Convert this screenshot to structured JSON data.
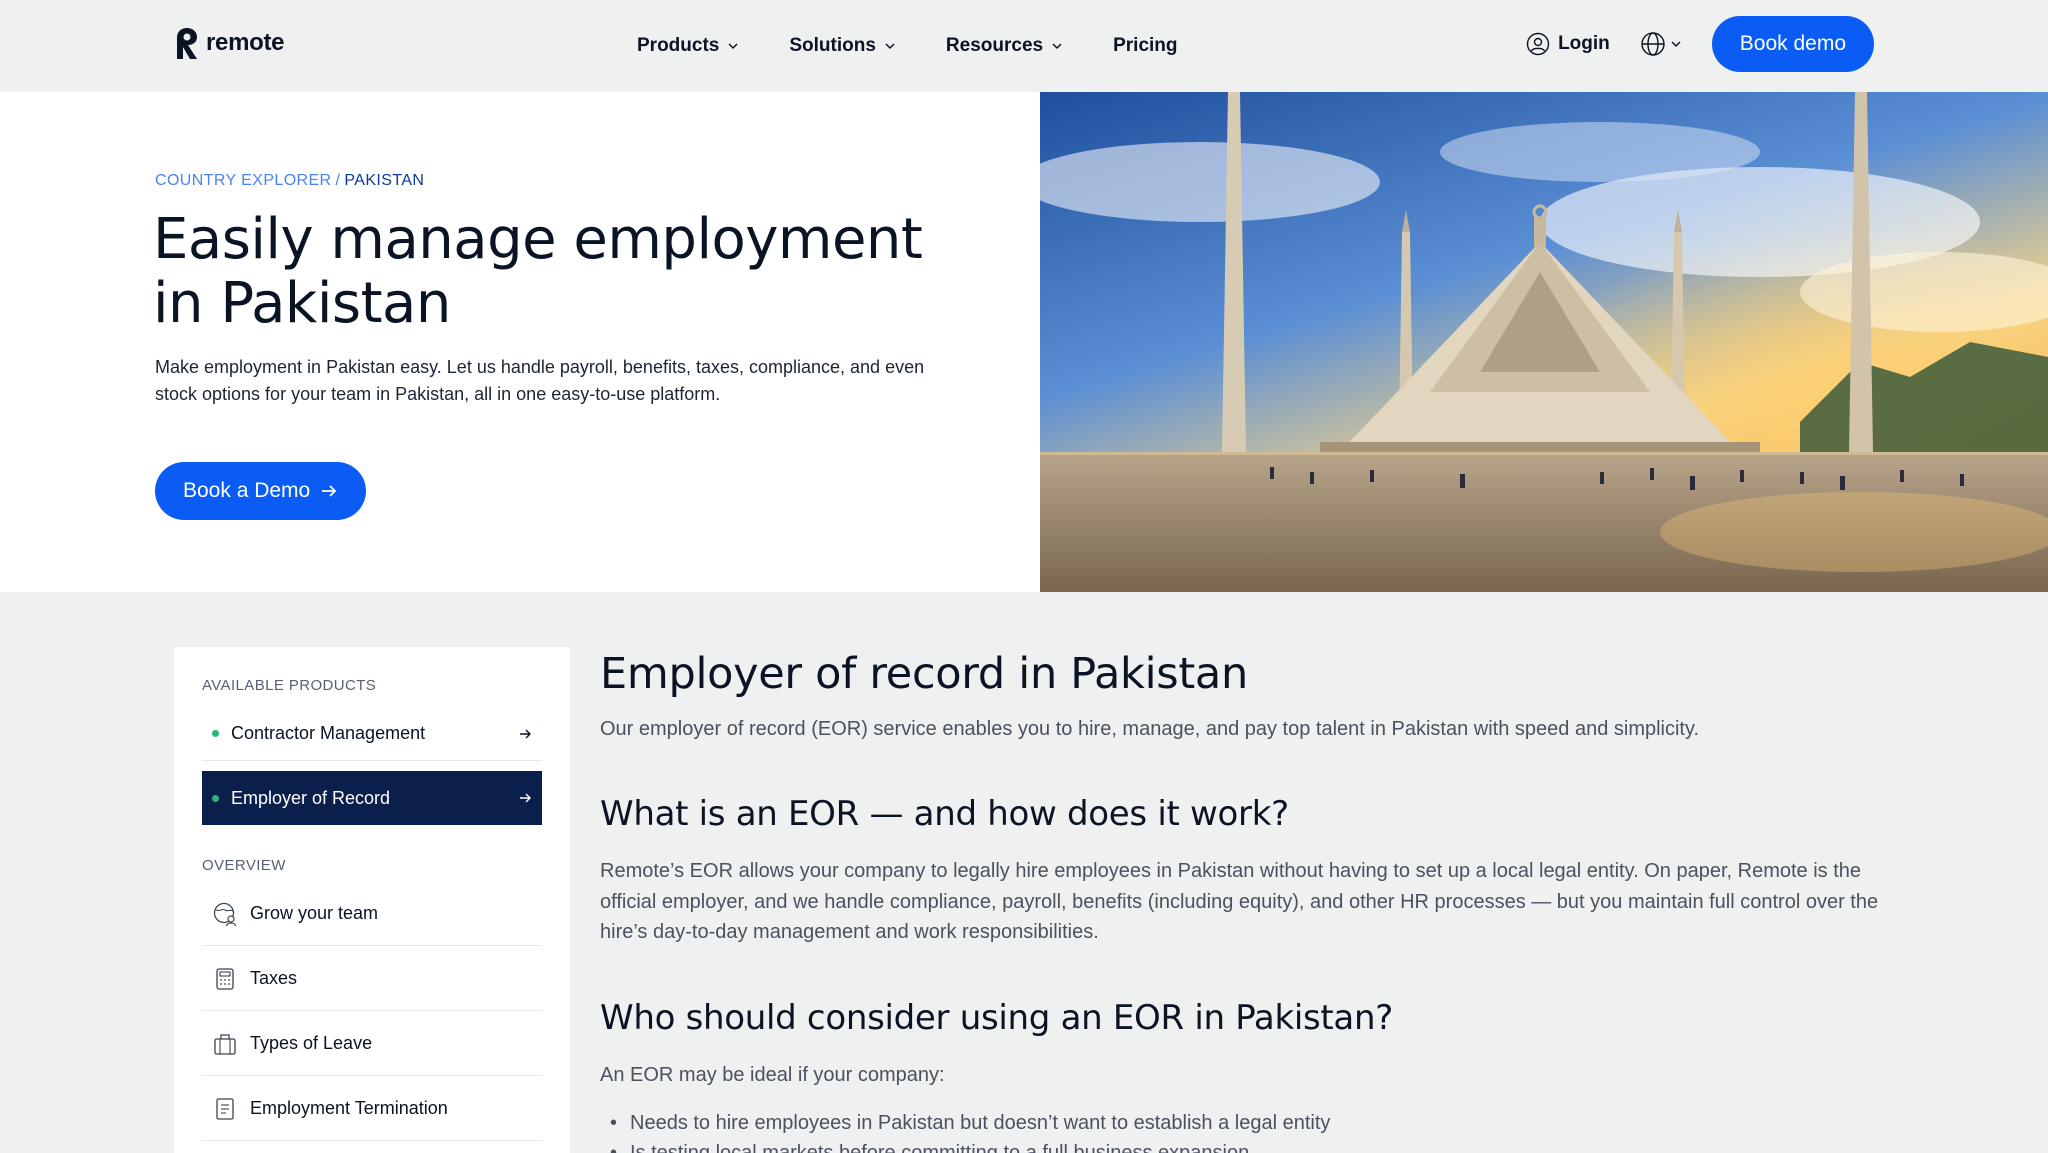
{
  "brand": {
    "name": "remote",
    "accent": "#0a5cf5",
    "navy": "#0b1f4d",
    "green_dot": "#2bb673"
  },
  "nav": {
    "menu": [
      {
        "label": "Products",
        "has_dropdown": true
      },
      {
        "label": "Solutions",
        "has_dropdown": true
      },
      {
        "label": "Resources",
        "has_dropdown": true
      },
      {
        "label": "Pricing",
        "has_dropdown": false
      }
    ],
    "login_label": "Login",
    "language_icon": "globe-icon",
    "cta_label": "Book demo"
  },
  "hero": {
    "breadcrumb": [
      "COUNTRY EXPLORER",
      "PAKISTAN"
    ],
    "breadcrumb_sep": "/",
    "title": "Easily manage employment in Pakistan",
    "description": "Make employment in Pakistan easy. Let us handle payroll, benefits, taxes, compliance, and even stock options for your team in Pakistan, all in one easy-to-use platform.",
    "cta_label": "Book a Demo"
  },
  "sidebar": {
    "products_heading": "AVAILABLE PRODUCTS",
    "products": [
      {
        "label": "Contractor Management",
        "active": false
      },
      {
        "label": "Employer of Record",
        "active": true
      }
    ],
    "overview_heading": "OVERVIEW",
    "overview": [
      {
        "label": "Grow your team",
        "icon": "globe-people-icon"
      },
      {
        "label": "Taxes",
        "icon": "calculator-icon"
      },
      {
        "label": "Types of Leave",
        "icon": "luggage-icon"
      },
      {
        "label": "Employment Termination",
        "icon": "document-icon"
      }
    ]
  },
  "main": {
    "heading_1": "Employer of record in Pakistan",
    "intro": "Our employer of record (EOR) service enables you to hire, manage, and pay top talent in Pakistan with speed and simplicity.",
    "heading_2": "What is an EOR — and how does it work?",
    "paragraph_2": "Remote’s EOR allows your company to legally hire employees in Pakistan without having to set up a local legal entity. On paper, Remote is the official employer, and we handle compliance, payroll, benefits (including equity), and other HR processes — but you maintain full control over the hire’s day-to-day management and work responsibilities.",
    "heading_3": "Who should consider using an EOR in Pakistan?",
    "paragraph_3": "An EOR may be ideal if your company:",
    "bullets": [
      "Needs to hire employees in Pakistan but doesn’t want to establish a legal entity",
      "Is testing local markets before committing to a full business expansion"
    ]
  }
}
